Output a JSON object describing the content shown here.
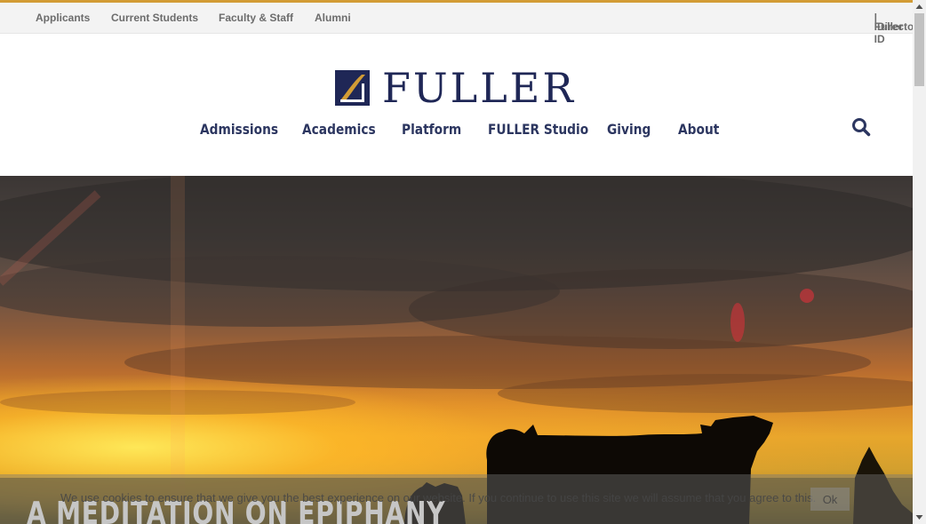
{
  "utility_nav": {
    "links": [
      "Applicants",
      "Current Students",
      "Faculty & Staff",
      "Alumni"
    ],
    "fuller_id": "Fuller ID",
    "separator": "|",
    "directory": "Directory"
  },
  "logo": {
    "text": "FULLER",
    "icon": "fuller-logo-mark"
  },
  "main_nav": {
    "items": [
      "Admissions",
      "Academics",
      "Platform",
      "FULLER Studio",
      "Giving",
      "About"
    ],
    "search_icon": "search-icon"
  },
  "hero": {
    "title": "A MEDITATION ON EPIPHANY"
  },
  "cookie_notice": {
    "text": "We use cookies to ensure that we give you the best experience on our website. If you continue to use this site we will assume that you agree to this.",
    "ok_label": "Ok"
  },
  "colors": {
    "accent": "#d29c35",
    "navy": "#1f2756",
    "nav_text": "#2c3660",
    "utility_text": "#6c6c6c"
  }
}
